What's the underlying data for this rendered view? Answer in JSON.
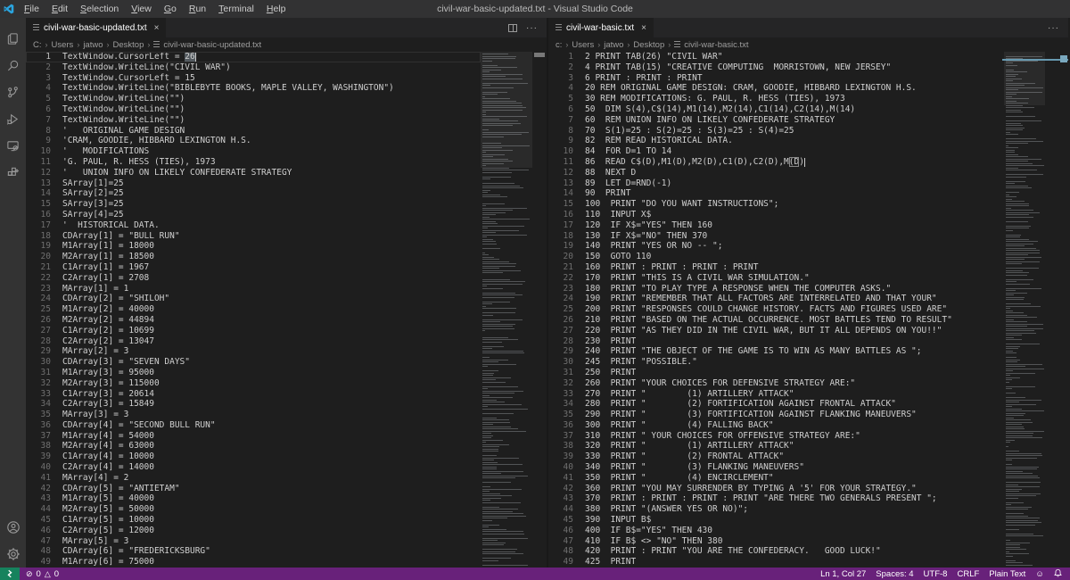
{
  "title_bar": {
    "title": "civil-war-basic-updated.txt - Visual Studio Code",
    "menus": [
      "File",
      "Edit",
      "Selection",
      "View",
      "Go",
      "Run",
      "Terminal",
      "Help"
    ]
  },
  "activity_bar": {
    "items": [
      "explorer",
      "search",
      "source-control",
      "run-and-debug",
      "remote-explorer",
      "extensions"
    ],
    "bottom_items": [
      "account",
      "settings"
    ]
  },
  "left_editor": {
    "tab": "civil-war-basic-updated.txt",
    "breadcrumb": [
      "C:",
      "Users",
      "jatwo",
      "Desktop"
    ],
    "breadcrumb_file": "civil-war-basic-updated.txt",
    "current_line": 1,
    "word_highlight": {
      "line": 1,
      "text": "26"
    },
    "lines": [
      "TextWindow.CursorLeft = 26",
      "TextWindow.WriteLine(\"CIVIL WAR\")",
      "TextWindow.CursorLeft = 15",
      "TextWindow.WriteLine(\"BIBLEBYTE BOOKS, MAPLE VALLEY, WASHINGTON\")",
      "TextWindow.WriteLine(\"\")",
      "TextWindow.WriteLine(\"\")",
      "TextWindow.WriteLine(\"\")",
      "'   ORIGINAL GAME DESIGN",
      "'CRAM, GOODIE, HIBBARD LEXINGTON H.S.",
      "'   MODIFICATIONS",
      "'G. PAUL, R. HESS (TIES), 1973",
      "'   UNION INFO ON LIKELY CONFEDERATE STRATEGY",
      "SArray[1]=25",
      "SArray[2]=25",
      "SArray[3]=25",
      "SArray[4]=25",
      "'  HISTORICAL DATA.",
      "CDArray[1] = \"BULL RUN\"",
      "M1Array[1] = 18000",
      "M2Array[1] = 18500",
      "C1Array[1] = 1967",
      "C2Array[1] = 2708",
      "MArray[1] = 1",
      "CDArray[2] = \"SHILOH\"",
      "M1Array[2] = 40000",
      "M2Array[2] = 44894",
      "C1Array[2] = 10699",
      "C2Array[2] = 13047",
      "MArray[2] = 3",
      "CDArray[3] = \"SEVEN DAYS\"",
      "M1Array[3] = 95000",
      "M2Array[3] = 115000",
      "C1Array[3] = 20614",
      "C2Array[3] = 15849",
      "MArray[3] = 3",
      "CDArray[4] = \"SECOND BULL RUN\"",
      "M1Array[4] = 54000",
      "M2Array[4] = 63000",
      "C1Array[4] = 10000",
      "C2Array[4] = 14000",
      "MArray[4] = 2",
      "CDArray[5] = \"ANTIETAM\"",
      "M1Array[5] = 40000",
      "M2Array[5] = 50000",
      "C1Array[5] = 10000",
      "C2Array[5] = 12000",
      "MArray[5] = 3",
      "CDArray[6] = \"FREDERICKSBURG\"",
      "M1Array[6] = 75000"
    ]
  },
  "right_editor": {
    "tab": "civil-war-basic.txt",
    "breadcrumb": [
      "c:",
      "Users",
      "jatwo",
      "Desktop"
    ],
    "breadcrumb_file": "civil-war-basic.txt",
    "bracket_highlight": {
      "line": 11,
      "text": "(D"
    },
    "lines": [
      "2 PRINT TAB(26) \"CIVIL WAR\"",
      "4 PRINT TAB(15) \"CREATIVE COMPUTING  MORRISTOWN, NEW JERSEY\"",
      "6 PRINT : PRINT : PRINT",
      "20 REM ORIGINAL GAME DESIGN: CRAM, GOODIE, HIBBARD LEXINGTON H.S.",
      "30 REM MODIFICATIONS: G. PAUL, R. HESS (TIES), 1973",
      "50  DIM S(4),C$(14),M1(14),M2(14),C1(14),C2(14),M(14)",
      "60  REM UNION INFO ON LIKELY CONFEDERATE STRATEGY",
      "70  S(1)=25 : S(2)=25 : S(3)=25 : S(4)=25",
      "82  REM READ HISTORICAL DATA.",
      "84  FOR D=1 TO 14",
      "86  READ C$(D),M1(D),M2(D),C1(D),C2(D),M(D)",
      "88  NEXT D",
      "89  LET D=RND(-1)",
      "90  PRINT",
      "100  PRINT \"DO YOU WANT INSTRUCTIONS\";",
      "110  INPUT X$",
      "120  IF X$=\"YES\" THEN 160",
      "130  IF X$=\"NO\" THEN 370",
      "140  PRINT \"YES OR NO -- \";",
      "150  GOTO 110",
      "160  PRINT : PRINT : PRINT : PRINT",
      "170  PRINT \"THIS IS A CIVIL WAR SIMULATION.\"",
      "180  PRINT \"TO PLAY TYPE A RESPONSE WHEN THE COMPUTER ASKS.\"",
      "190  PRINT \"REMEMBER THAT ALL FACTORS ARE INTERRELATED AND THAT YOUR\"",
      "200  PRINT \"RESPONSES COULD CHANGE HISTORY. FACTS AND FIGURES USED ARE\"",
      "210  PRINT \"BASED ON THE ACTUAL OCCURRENCE. MOST BATTLES TEND TO RESULT\"",
      "220  PRINT \"AS THEY DID IN THE CIVIL WAR, BUT IT ALL DEPENDS ON YOU!!\"",
      "230  PRINT",
      "240  PRINT \"THE OBJECT OF THE GAME IS TO WIN AS MANY BATTLES AS \";",
      "245  PRINT \"POSSIBLE.\"",
      "250  PRINT",
      "260  PRINT \"YOUR CHOICES FOR DEFENSIVE STRATEGY ARE:\"",
      "270  PRINT \"        (1) ARTILLERY ATTACK\"",
      "280  PRINT \"        (2) FORTIFICATION AGAINST FRONTAL ATTACK\"",
      "290  PRINT \"        (3) FORTIFICATION AGAINST FLANKING MANEUVERS\"",
      "300  PRINT \"        (4) FALLING BACK\"",
      "310  PRINT \" YOUR CHOICES FOR OFFENSIVE STRATEGY ARE:\"",
      "320  PRINT \"        (1) ARTILLERY ATTACK\"",
      "330  PRINT \"        (2) FRONTAL ATTACK\"",
      "340  PRINT \"        (3) FLANKING MANEUVERS\"",
      "350  PRINT \"        (4) ENCIRCLEMENT\"",
      "360  PRINT \"YOU MAY SURRENDER BY TYPING A '5' FOR YOUR STRATEGY.\"",
      "370  PRINT : PRINT : PRINT : PRINT \"ARE THERE TWO GENERALS PRESENT \";",
      "380  PRINT \"(ANSWER YES OR NO)\";",
      "390  INPUT B$",
      "400  IF B$=\"YES\" THEN 430",
      "410  IF B$ <> \"NO\" THEN 380",
      "420  PRINT : PRINT \"YOU ARE THE CONFEDERACY.   GOOD LUCK!\"",
      "425  PRINT"
    ]
  },
  "status_bar": {
    "errors": "0",
    "warnings": "0",
    "error_icon": "⊘",
    "warning_icon": "△",
    "cursor": "Ln 1, Col 27",
    "indentation": "Spaces: 4",
    "encoding": "UTF-8",
    "eol": "CRLF",
    "language": "Plain Text",
    "feedback_icon": "☺"
  },
  "colors": {
    "status_bar_bg": "#68217A",
    "remote_bg": "#16825D",
    "editor_bg": "#1e1e1e",
    "titlebar_bg": "#323233",
    "logo_blue": "#2aa5e0"
  }
}
